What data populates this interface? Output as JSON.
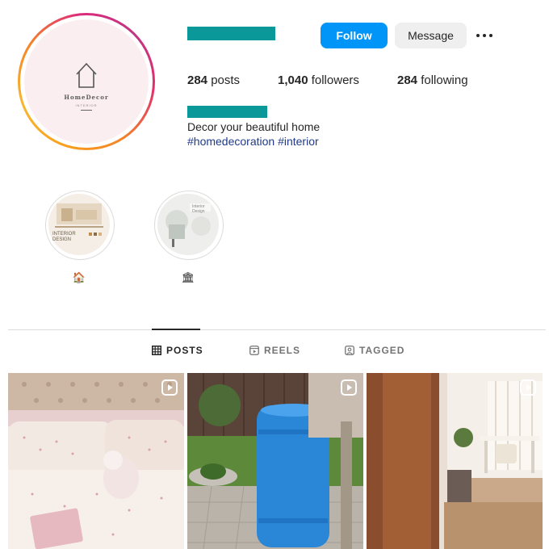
{
  "profile": {
    "bio": "Decor your beautiful home",
    "hashtags": "#homedecoration #interior",
    "logo_text": "HomeDecor",
    "logo_sub": "INTERIOR"
  },
  "actions": {
    "follow_label": "Follow",
    "message_label": "Message"
  },
  "stats": [
    {
      "value": "284",
      "label": "posts"
    },
    {
      "value": "1,040",
      "label": "followers"
    },
    {
      "value": "284",
      "label": "following"
    }
  ],
  "highlights": [
    {
      "label": "🏠",
      "cover_text": "INTERIOR DESIGN"
    },
    {
      "label": "🏛",
      "cover_text": "Interior Design"
    }
  ],
  "tabs": [
    {
      "label": "POSTS",
      "icon": "grid-icon",
      "active": true
    },
    {
      "label": "REELS",
      "icon": "reels-icon",
      "active": false
    },
    {
      "label": "TAGGED",
      "icon": "tagged-icon",
      "active": false
    }
  ],
  "posts": [
    {
      "type": "reel",
      "subject": "bedroom"
    },
    {
      "type": "reel",
      "subject": "garden"
    },
    {
      "type": "reel",
      "subject": "interior"
    }
  ],
  "colors": {
    "accent": "#0095f6",
    "redaction": "#0b9898",
    "hashtag": "#1f3a8a"
  }
}
